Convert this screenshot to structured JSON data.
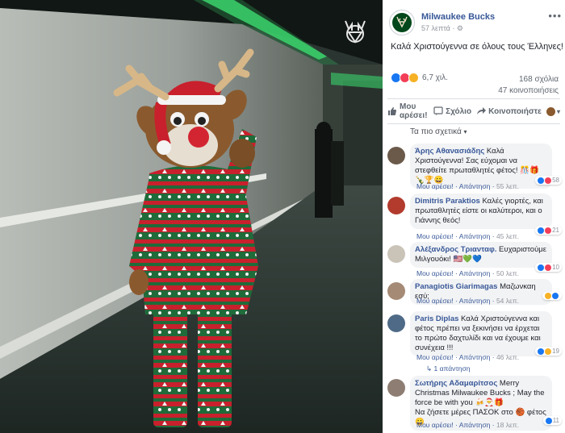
{
  "post": {
    "page_name": "Milwaukee Bucks",
    "time": "57 λεπτά",
    "text": "Καλά Χριστούγεννα σε όλους τους Έλληνες!",
    "reactions_count": "6,7 χιλ.",
    "comments_count": "168 σχόλια",
    "shares_count": "47 κοινοποιήσεις"
  },
  "actions": {
    "like": "Μου αρέσει!",
    "comment": "Σχόλιο",
    "share": "Κοινοποιήστε"
  },
  "sort_label": "Τα πιο σχετικά",
  "comments": [
    {
      "name": "Άρης Αθανασιάδης",
      "text": "Καλά Χριστούγεννα! Σας εύχομαι να στεφθείτε πρωταθλητές φέτος!",
      "like": "Μου αρέσει!",
      "reply": "Απάντηση",
      "time": "55 λεπ.",
      "reactions": "58"
    },
    {
      "name": "Dimitris Paraktios",
      "text": "Καλές γιορτές, και πρωταθλητές είστε οι καλύτεροι, και ο Γιάννης θεός!",
      "like": "Μου αρέσει!",
      "reply": "Απάντηση",
      "time": "45 λεπ.",
      "reactions": "21"
    },
    {
      "name": "Αλέξανδρος Τριανταφ.",
      "text": "Ευχαριστούμε Μιλγουόκι!",
      "like": "Μου αρέσει!",
      "reply": "Απάντηση",
      "time": "50 λεπ.",
      "reactions": "10"
    },
    {
      "name": "Panagiotis Giarimagas",
      "text": "Μαζωνκαη εσύ;",
      "like": "Μου αρέσει!",
      "reply": "Απάντηση",
      "time": "54 λεπ.",
      "reactions": ""
    },
    {
      "name": "Paris Diplas",
      "text": "Καλά Χριστούγεννα και φέτος πρέπει να ξεκινήσει να έρχεται το πρώτο δαχτυλίδι και να έχουμε και συνέχεια !!!",
      "like": "Μου αρέσει!",
      "reply": "Απάντηση",
      "time": "46 λεπ.",
      "reactions": "19"
    },
    {
      "name": "Σωτήρης Αδαμαρίτσος",
      "text": "Merry Christmas Milwaukee Bucks ; May the force be with you",
      "text2": "Να ζήσετε μέρες ΠΑΣΟΚ στο",
      "text3": "φέτος",
      "like": "Μου αρέσει!",
      "reply": "Απάντηση",
      "time": "18 λεπ.",
      "reactions": "11"
    }
  ],
  "replies_link": "1 απάντηση",
  "colors": {
    "link": "#385898",
    "like_blue": "#1877f2",
    "love_red": "#f33e58",
    "haha_yellow": "#f7b125",
    "suit_green": "#1f6b3a",
    "suit_red": "#c8202c"
  }
}
